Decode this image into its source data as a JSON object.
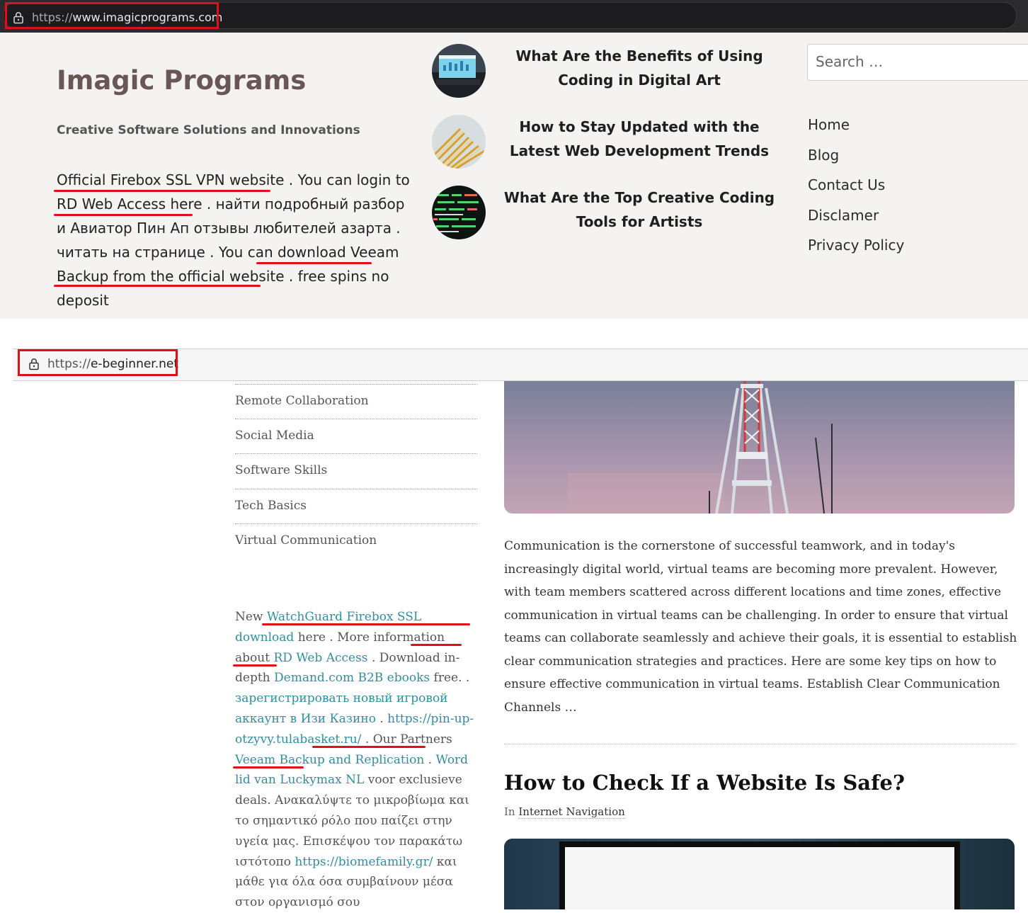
{
  "browser_top": {
    "url_scheme": "https://",
    "url_host": "www.imagicprograms.com"
  },
  "site1": {
    "title": "Imagic Programs",
    "tagline": "Creative Software Solutions and Innovations",
    "body": {
      "link1": "Official Firebox SSL VPN website",
      "text1": " . You can login to ",
      "link2": "RD Web Access here",
      "text2": " . найти подробный разбор и Авиатор Пин Ап отзывы любителей азарта . читать на странице . You can ",
      "link3": "download Veeam Backup from the official website",
      "text3": " . free spins no deposit"
    },
    "posts": [
      {
        "title": "What Are the Benefits of Using Coding in Digital Art"
      },
      {
        "title": "How to Stay Updated with the Latest Web Development Trends"
      },
      {
        "title": "What Are the Top Creative Coding Tools for Artists"
      }
    ],
    "search_placeholder": "Search …",
    "nav": [
      "Home",
      "Blog",
      "Contact Us",
      "Disclamer",
      "Privacy Policy"
    ]
  },
  "browser_second": {
    "url_scheme": "https://",
    "url_host": "e-beginner.net"
  },
  "site2": {
    "categories": [
      "Remote Collaboration",
      "Social Media",
      "Software Skills",
      "Tech Basics",
      "Virtual Communication"
    ],
    "links_block": {
      "t1": "New ",
      "l1": "WatchGuard Firebox SSL download",
      "t2": " here . More information about ",
      "l2": "RD Web Access",
      "t3": " . Download in-depth ",
      "l3": "Demand.com B2B ebooks",
      "t4": " free. . ",
      "l4": "зарегистрировать новый игровой аккаунт в Изи Казино",
      "t5": " . ",
      "l5": "https://pin-up-otzyvy.tulabasket.ru/",
      "t6": " . Our Partners ",
      "l6": "Veeam Backup and Replication",
      "t7": " . ",
      "l7": "Word lid van Luckymax NL",
      "t8": " voor exclusieve deals. Ανακαλύψτε το μικροβίωμα και το σημαντικό ρόλο που παίζει στην υγεία μας. Επισκέψου τον παρακάτω ιστότοπο ",
      "l8": "https://biomefamily.gr/",
      "t9": " και μάθε για όλα όσα συμβαίνουν μέσα στον οργανισμό σου"
    },
    "excerpt": "Communication is the cornerstone of successful teamwork, and in today's increasingly digital world, virtual teams are becoming more prevalent. However, with team members scattered across different locations and time zones, effective communication in virtual teams can be challenging. In order to ensure that virtual teams can collaborate seamlessly and achieve their goals, it is essential to establish clear communication strategies and practices. Here are some key tips on how to ensure effective communication in virtual teams. Establish Clear Communication Channels …",
    "post_title": "How to Check If a Website Is Safe?",
    "meta_prefix": "In ",
    "meta_category": "Internet Navigation"
  }
}
